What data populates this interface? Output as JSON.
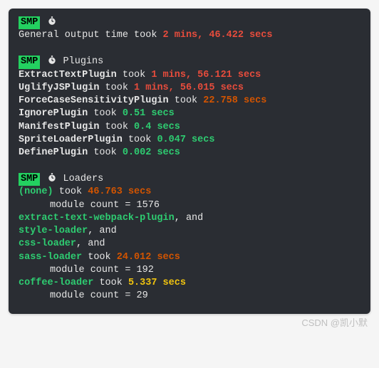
{
  "badge": "SMP",
  "icon": "stopwatch-icon",
  "general_line": {
    "prefix": "General output time took",
    "time": "2 mins, 46.422 secs"
  },
  "plugins": {
    "header": "Plugins",
    "items": [
      {
        "name": "ExtractTextPlugin",
        "took": "took",
        "time": "1 mins, 56.121 secs",
        "color": "red"
      },
      {
        "name": "UglifyJSPlugin",
        "took": "took",
        "time": "1 mins, 56.015 secs",
        "color": "red"
      },
      {
        "name": "ForceCaseSensitivityPlugin",
        "took": "took",
        "time": "22.758 secs",
        "color": "orange"
      },
      {
        "name": "IgnorePlugin",
        "took": "took",
        "time": "0.51 secs",
        "color": "green"
      },
      {
        "name": "ManifestPlugin",
        "took": "took",
        "time": "0.4 secs",
        "color": "green"
      },
      {
        "name": "SpriteLoaderPlugin",
        "took": "took",
        "time": "0.047 secs",
        "color": "green"
      },
      {
        "name": "DefinePlugin",
        "took": "took",
        "time": "0.002 secs",
        "color": "green"
      }
    ]
  },
  "loaders": {
    "header": "Loaders",
    "items": [
      {
        "name": "(none)",
        "name_color": "green",
        "took": "took",
        "time": "46.763 secs",
        "color": "orange",
        "module_count_label": "module count =",
        "module_count": "1576"
      },
      {
        "name": "extract-text-webpack-plugin",
        "name_color": "green",
        "suffix": ", and"
      },
      {
        "name": "style-loader",
        "name_color": "green",
        "suffix": ", and"
      },
      {
        "name": "css-loader",
        "name_color": "green",
        "suffix": ", and"
      },
      {
        "name": "sass-loader",
        "name_color": "green",
        "took": "took",
        "time": "24.012 secs",
        "color": "orange",
        "module_count_label": "module count =",
        "module_count": "192"
      },
      {
        "name": "coffee-loader",
        "name_color": "green",
        "took": "took",
        "time": "5.337 secs",
        "color": "yellow",
        "module_count_label": "module count =",
        "module_count": "29"
      }
    ]
  },
  "watermark": "CSDN @凯小默"
}
